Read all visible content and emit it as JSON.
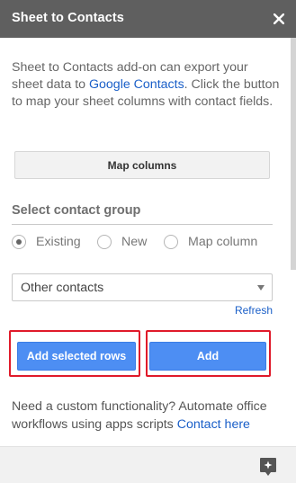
{
  "header": {
    "title": "Sheet to Contacts",
    "close_icon": "close-icon"
  },
  "intro": {
    "text_before": "Sheet to Contacts add-on can export your sheet data to ",
    "link": "Google Contacts",
    "text_after": ". Click the button to map your sheet columns with contact fields."
  },
  "map_button": {
    "label": "Map columns"
  },
  "contact_group": {
    "title": "Select contact group",
    "options": [
      {
        "label": "Existing",
        "selected": true
      },
      {
        "label": "New",
        "selected": false
      },
      {
        "label": "Map column",
        "selected": false
      }
    ],
    "select_value": "Other contacts",
    "refresh_label": "Refresh"
  },
  "actions": {
    "add_selected_label": "Add selected rows",
    "add_label": "Add"
  },
  "footer": {
    "text": "Need a custom functionality? Automate office workflows using apps scripts ",
    "link": "Contact here"
  },
  "colors": {
    "header_bg": "#5f5f5f",
    "link": "#1a5fc8",
    "primary_button": "#4d8ef3",
    "highlight": "#e01a2a"
  },
  "icons": {
    "feedback": "feedback-icon"
  }
}
